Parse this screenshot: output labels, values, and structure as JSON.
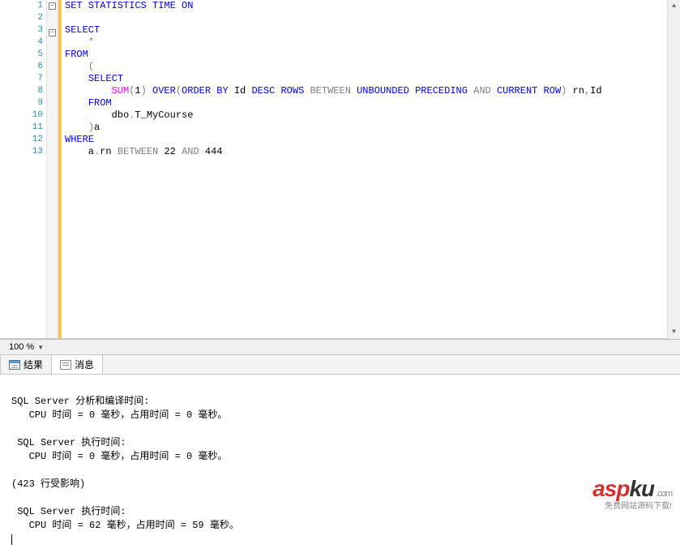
{
  "editor": {
    "line_count": 13,
    "tokens": [
      [
        [
          "kw-blue",
          "SET STATISTICS TIME ON"
        ]
      ],
      [],
      [
        [
          "kw-blue",
          "SELECT"
        ]
      ],
      [
        [
          "txt-black",
          "    "
        ],
        [
          "kw-gray",
          "*"
        ]
      ],
      [
        [
          "kw-blue",
          "FROM"
        ]
      ],
      [
        [
          "txt-black",
          "    "
        ],
        [
          "kw-gray",
          "("
        ]
      ],
      [
        [
          "txt-black",
          "    "
        ],
        [
          "kw-blue",
          "SELECT"
        ]
      ],
      [
        [
          "txt-black",
          "        "
        ],
        [
          "kw-pink",
          "SUM"
        ],
        [
          "kw-gray",
          "("
        ],
        [
          "txt-black",
          "1"
        ],
        [
          "kw-gray",
          ") "
        ],
        [
          "kw-blue",
          "OVER"
        ],
        [
          "kw-gray",
          "("
        ],
        [
          "kw-blue",
          "ORDER BY"
        ],
        [
          "txt-black",
          " Id "
        ],
        [
          "kw-blue",
          "DESC ROWS "
        ],
        [
          "kw-gray",
          "BETWEEN "
        ],
        [
          "kw-blue",
          "UNBOUNDED PRECEDING "
        ],
        [
          "kw-gray",
          "AND "
        ],
        [
          "kw-blue",
          "CURRENT ROW"
        ],
        [
          "kw-gray",
          ")"
        ],
        [
          "txt-black",
          " rn"
        ],
        [
          "kw-gray",
          ","
        ],
        [
          "txt-black",
          "Id"
        ]
      ],
      [
        [
          "txt-black",
          "    "
        ],
        [
          "kw-blue",
          "FROM"
        ]
      ],
      [
        [
          "txt-black",
          "        dbo"
        ],
        [
          "kw-gray",
          "."
        ],
        [
          "txt-black",
          "T_MyCourse"
        ]
      ],
      [
        [
          "txt-black",
          "    "
        ],
        [
          "kw-gray",
          ")"
        ],
        [
          "txt-black",
          "a"
        ]
      ],
      [
        [
          "kw-blue",
          "WHERE"
        ]
      ],
      [
        [
          "txt-black",
          "    a"
        ],
        [
          "kw-gray",
          "."
        ],
        [
          "txt-black",
          "rn "
        ],
        [
          "kw-gray",
          "BETWEEN"
        ],
        [
          "txt-black",
          " 22 "
        ],
        [
          "kw-gray",
          "AND"
        ],
        [
          "txt-black",
          " 444"
        ]
      ]
    ],
    "fold_marks": {
      "1": "-",
      "3": "-"
    }
  },
  "zoom": {
    "value": "100 %"
  },
  "tabs": {
    "results": "结果",
    "messages": "消息"
  },
  "messages": {
    "block1_title": "SQL Server 分析和编译时间:",
    "block1_line": "   CPU 时间 = 0 毫秒，占用时间 = 0 毫秒。",
    "block2_title": " SQL Server 执行时间:",
    "block2_line": "   CPU 时间 = 0 毫秒，占用时间 = 0 毫秒。",
    "rows_affected": "(423 行受影响)",
    "block3_title": " SQL Server 执行时间:",
    "block3_line": "   CPU 时间 = 62 毫秒，占用时间 = 59 毫秒。"
  },
  "watermark": {
    "asp": "asp",
    "ku": "ku",
    "dotcom": ".com",
    "sub": "免费网站源码下载!"
  }
}
